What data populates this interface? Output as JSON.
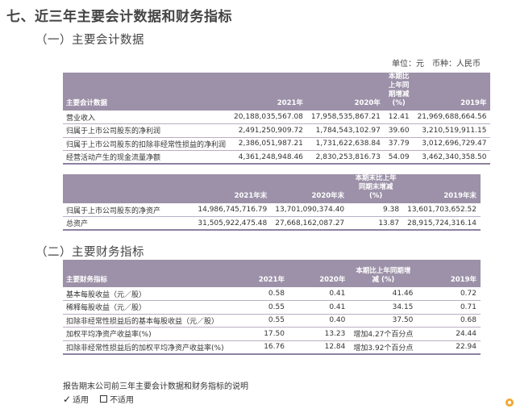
{
  "section_title": "七、近三年主要会计数据和财务指标",
  "sub1_title": "（一）主要会计数据",
  "sub2_title": "（二）主要财务指标",
  "unit": {
    "unit_label": "单位：元",
    "currency_label": "币种：人民币"
  },
  "table1": {
    "headers": [
      "主要会计数据",
      "2021年",
      "2020年",
      "本期比上年同期增减 (%)",
      "2019年"
    ],
    "rows": [
      [
        "营业收入",
        "20,188,035,567.08",
        "17,958,535,867.21",
        "12.41",
        "21,969,688,664.56"
      ],
      [
        "归属于上市公司股东的净利润",
        "2,491,250,909.72",
        "1,784,543,102.97",
        "39.60",
        "3,210,519,911.15"
      ],
      [
        "归属于上市公司股东的扣除非经常性损益的净利润",
        "2,386,051,987.21",
        "1,731,622,638.84",
        "37.79",
        "3,012,696,729.47"
      ],
      [
        "经营活动产生的现金流量净额",
        "4,361,248,948.46",
        "2,830,253,816.73",
        "54.09",
        "3,462,340,358.50"
      ]
    ]
  },
  "table2": {
    "headers": [
      "",
      "2021年末",
      "2020年末",
      "本期末比上年 同期末增减(%)",
      "2019年末"
    ],
    "rows": [
      [
        "归属于上市公司股东的净资产",
        "14,986,745,716.79",
        "13,701,090,374.40",
        "9.38",
        "13,601,703,652.52"
      ],
      [
        "总资产",
        "31,505,922,475.48",
        "27,668,162,087.27",
        "13.87",
        "28,915,724,316.14"
      ]
    ]
  },
  "table3": {
    "headers": [
      "主要财务指标",
      "2021年",
      "2020年",
      "本期比上年同期增减 (%)",
      "2019年"
    ],
    "rows": [
      [
        "基本每股收益（元／股）",
        "0.58",
        "0.41",
        "41.46",
        "0.72"
      ],
      [
        "稀释每股收益（元／股）",
        "0.55",
        "0.41",
        "34.15",
        "0.71"
      ],
      [
        "扣除非经常性损益后的基本每股收益（元／股）",
        "0.55",
        "0.40",
        "37.50",
        "0.68"
      ],
      [
        "加权平均净资产收益率(%)",
        "17.50",
        "13.23",
        "增加4.27个百分点",
        "24.44"
      ],
      [
        "扣除非经常性损益后的加权平均净资产收益率(%)",
        "16.76",
        "12.84",
        "增加3.92个百分点",
        "22.94"
      ]
    ]
  },
  "note": "报告期末公司前三年主要会计数据和财务指标的说明",
  "options": {
    "applicable": "适用",
    "not_applicable": "不适用",
    "check_mark": "✓"
  }
}
